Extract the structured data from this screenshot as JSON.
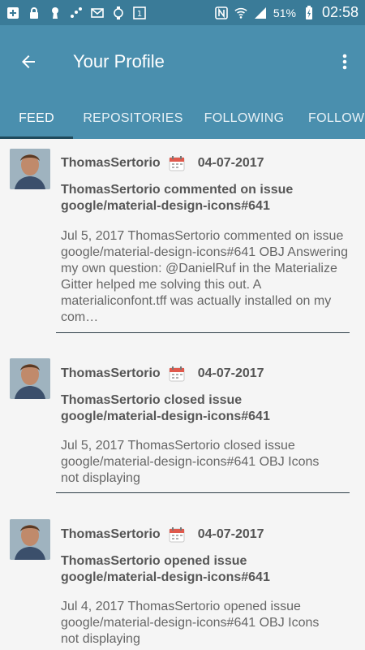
{
  "status_bar": {
    "battery": "51%",
    "time": "02:58"
  },
  "app_bar": {
    "title": "Your Profile"
  },
  "tabs": [
    {
      "label": "FEED"
    },
    {
      "label": "REPOSITORIES"
    },
    {
      "label": "FOLLOWING"
    },
    {
      "label": "FOLLOWERS"
    }
  ],
  "feed": [
    {
      "user": "ThomasSertorio",
      "date": "04-07-2017",
      "title": "ThomasSertorio commented on issue google/material-design-icons#641",
      "body": "Jul 5, 2017 ThomasSertorio commented on issue google/material-design-icons#641 OBJ Answering my own question: @DanielRuf in the Materialize Gitter helped me solving this out. A materialiconfont.tff was actually installed on my com…"
    },
    {
      "user": "ThomasSertorio",
      "date": "04-07-2017",
      "title": "ThomasSertorio closed issue google/material-design-icons#641",
      "body": "Jul 5, 2017 ThomasSertorio closed issue google/material-design-icons#641 OBJ Icons not displaying"
    },
    {
      "user": "ThomasSertorio",
      "date": "04-07-2017",
      "title": "ThomasSertorio opened issue google/material-design-icons#641",
      "body": "Jul 4, 2017 ThomasSertorio opened issue google/material-design-icons#641 OBJ Icons not displaying"
    }
  ],
  "colors": {
    "status_bar": "#3a7b98",
    "app_bar": "#4a8fae",
    "tab_indicator": "#1f4a5c",
    "background": "#f5f5f5"
  }
}
